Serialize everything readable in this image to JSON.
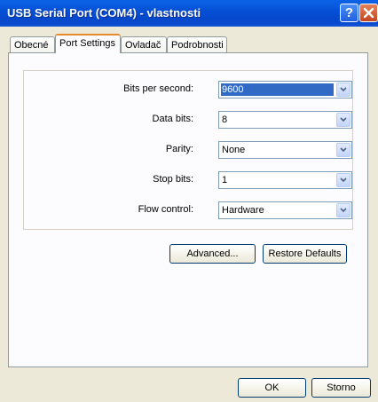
{
  "window": {
    "title": "USB Serial Port (COM4)  - vlastnosti"
  },
  "tabs": [
    {
      "label": "Obecné"
    },
    {
      "label": "Port Settings"
    },
    {
      "label": "Ovladač"
    },
    {
      "label": "Podrobnosti"
    }
  ],
  "settings": {
    "bits_per_second": {
      "label": "Bits per second:",
      "value": "9600"
    },
    "data_bits": {
      "label": "Data bits:",
      "value": "8"
    },
    "parity": {
      "label": "Parity:",
      "value": "None"
    },
    "stop_bits": {
      "label": "Stop bits:",
      "value": "1"
    },
    "flow_control": {
      "label": "Flow control:",
      "value": "Hardware"
    }
  },
  "buttons": {
    "advanced": "Advanced...",
    "restore_defaults": "Restore Defaults",
    "ok": "OK",
    "cancel": "Storno"
  },
  "colors": {
    "titlebar": "#0550d6",
    "selection": "#316ac5",
    "active_tab_accent": "#e68b2c"
  },
  "icons": {
    "help": "question-mark-icon",
    "close": "close-x-icon",
    "dropdown": "chevron-down-icon"
  }
}
